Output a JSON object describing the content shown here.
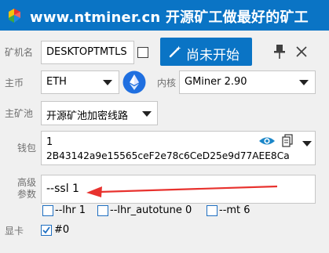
{
  "window": {
    "title": "www.ntminer.cn 开源矿工做最好的矿工"
  },
  "miner": {
    "label": "矿机名",
    "value": "DESKTOPTMTLS"
  },
  "start": {
    "label": "尚未开始"
  },
  "coin": {
    "label": "主币",
    "value": "ETH",
    "icon": "ethereum-icon"
  },
  "kernel": {
    "label": "内核",
    "value": "GMiner 2.90"
  },
  "pool": {
    "label": "主矿池",
    "value": "开源矿池加密线路"
  },
  "wallet": {
    "label": "钱包",
    "index": "1",
    "address": "2B43142a9e15565ceF2e78c6CeD25e9d77AEE8Ca"
  },
  "advanced": {
    "label_line1": "高级",
    "label_line2": "参数",
    "value": "--ssl 1"
  },
  "options": [
    {
      "label": "--lhr 1",
      "checked": false
    },
    {
      "label": "--lhr_autotune 0",
      "checked": false
    },
    {
      "label": "--mt 6",
      "checked": false
    }
  ],
  "gpu": {
    "label": "显卡",
    "items": [
      {
        "label": "#0",
        "checked": true
      }
    ]
  },
  "colors": {
    "titlebar": "#0a74c5",
    "button": "#0a74c5",
    "arrow": "#e8322e"
  }
}
